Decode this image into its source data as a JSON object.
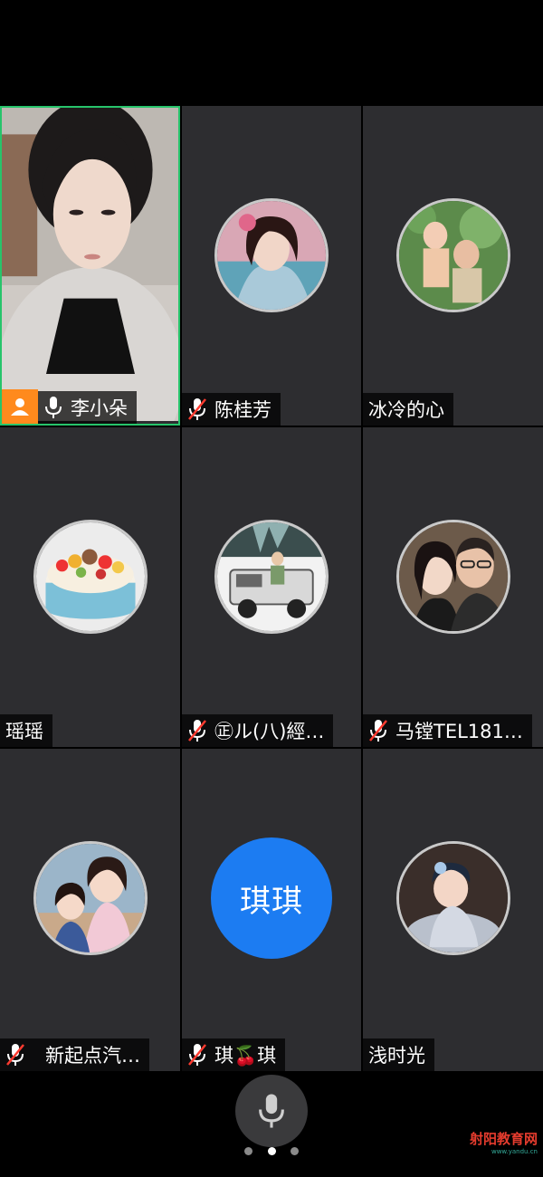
{
  "participants": [
    {
      "name": "李小朵",
      "mic": "on",
      "type": "video",
      "active": true
    },
    {
      "name": "陈桂芳",
      "mic": "muted",
      "type": "avatar"
    },
    {
      "name": "冰冷的心",
      "mic": "none",
      "type": "avatar"
    },
    {
      "name": "瑶瑶",
      "mic": "none",
      "type": "avatar"
    },
    {
      "name": "㊣ル(八)經…",
      "mic": "muted",
      "type": "avatar"
    },
    {
      "name": "马镗TEL181…",
      "mic": "muted",
      "type": "avatar"
    },
    {
      "name": "新起点汽…",
      "mic": "muted",
      "type": "avatar"
    },
    {
      "name": "琪🍒琪",
      "mic": "muted",
      "type": "text-avatar",
      "avatar_text": "琪琪"
    },
    {
      "name": "浅时光",
      "mic": "none",
      "type": "avatar"
    }
  ],
  "pager": {
    "pages": 3,
    "current": 2
  },
  "watermark": {
    "text": "射阳教育网",
    "sub": "www.yandu.cn"
  },
  "colors": {
    "tile_bg": "#2d2d30",
    "active_border": "#27c46b",
    "text_avatar_bg": "#1c7cf2",
    "badge": "#ff8a1d",
    "muted_slash": "#ff3b30"
  }
}
